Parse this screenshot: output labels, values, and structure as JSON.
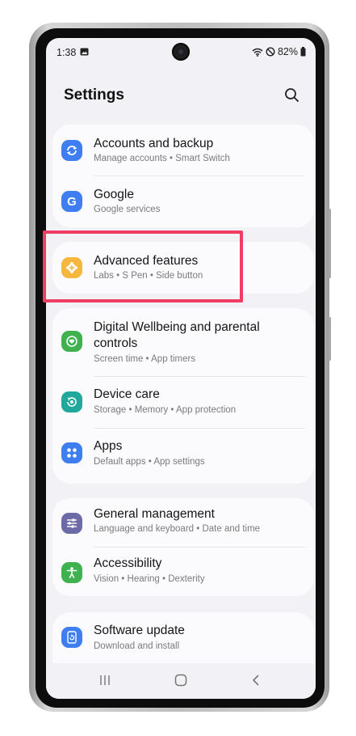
{
  "status_bar": {
    "time": "1:38",
    "battery": "82%",
    "icons": [
      "gallery-icon",
      "wifi-icon",
      "do-not-disturb-icon",
      "battery-icon"
    ]
  },
  "header": {
    "title": "Settings",
    "search_icon": "search-icon"
  },
  "groups": [
    {
      "items": [
        {
          "title": "Accounts and backup",
          "subtitle": "Manage accounts  •  Smart Switch",
          "icon": "sync-icon",
          "color": "#3e7ef0"
        },
        {
          "title": "Google",
          "subtitle": "Google services",
          "icon": "google-icon",
          "color": "#3e7ef0"
        }
      ]
    },
    {
      "items": [
        {
          "title": "Advanced features",
          "subtitle": "Labs  •  S Pen  •  Side button",
          "icon": "gear-plus-icon",
          "color": "#f5b73d",
          "highlighted": true
        }
      ]
    },
    {
      "items": [
        {
          "title": "Digital Wellbeing and parental controls",
          "subtitle": "Screen time  •  App timers",
          "icon": "heart-circle-icon",
          "color": "#3fb24f"
        },
        {
          "title": "Device care",
          "subtitle": "Storage  •  Memory  •  App protection",
          "icon": "device-care-icon",
          "color": "#1fa89b"
        },
        {
          "title": "Apps",
          "subtitle": "Default apps  •  App settings",
          "icon": "apps-grid-icon",
          "color": "#3e7ef0"
        }
      ]
    },
    {
      "items": [
        {
          "title": "General management",
          "subtitle": "Language and keyboard  •  Date and time",
          "icon": "sliders-icon",
          "color": "#6d6aa8"
        },
        {
          "title": "Accessibility",
          "subtitle": "Vision  •  Hearing  •  Dexterity",
          "icon": "accessibility-icon",
          "color": "#3fb24f"
        }
      ]
    },
    {
      "items": [
        {
          "title": "Software update",
          "subtitle": "Download and install",
          "icon": "update-icon",
          "color": "#3e7ef0"
        }
      ]
    }
  ],
  "nav_bar": {
    "buttons": [
      "recents-icon",
      "home-icon",
      "back-icon"
    ]
  },
  "colors": {
    "highlight": "#ee3e63",
    "screen_bg": "#f2f2f6",
    "card_bg": "#fbfbfd"
  }
}
